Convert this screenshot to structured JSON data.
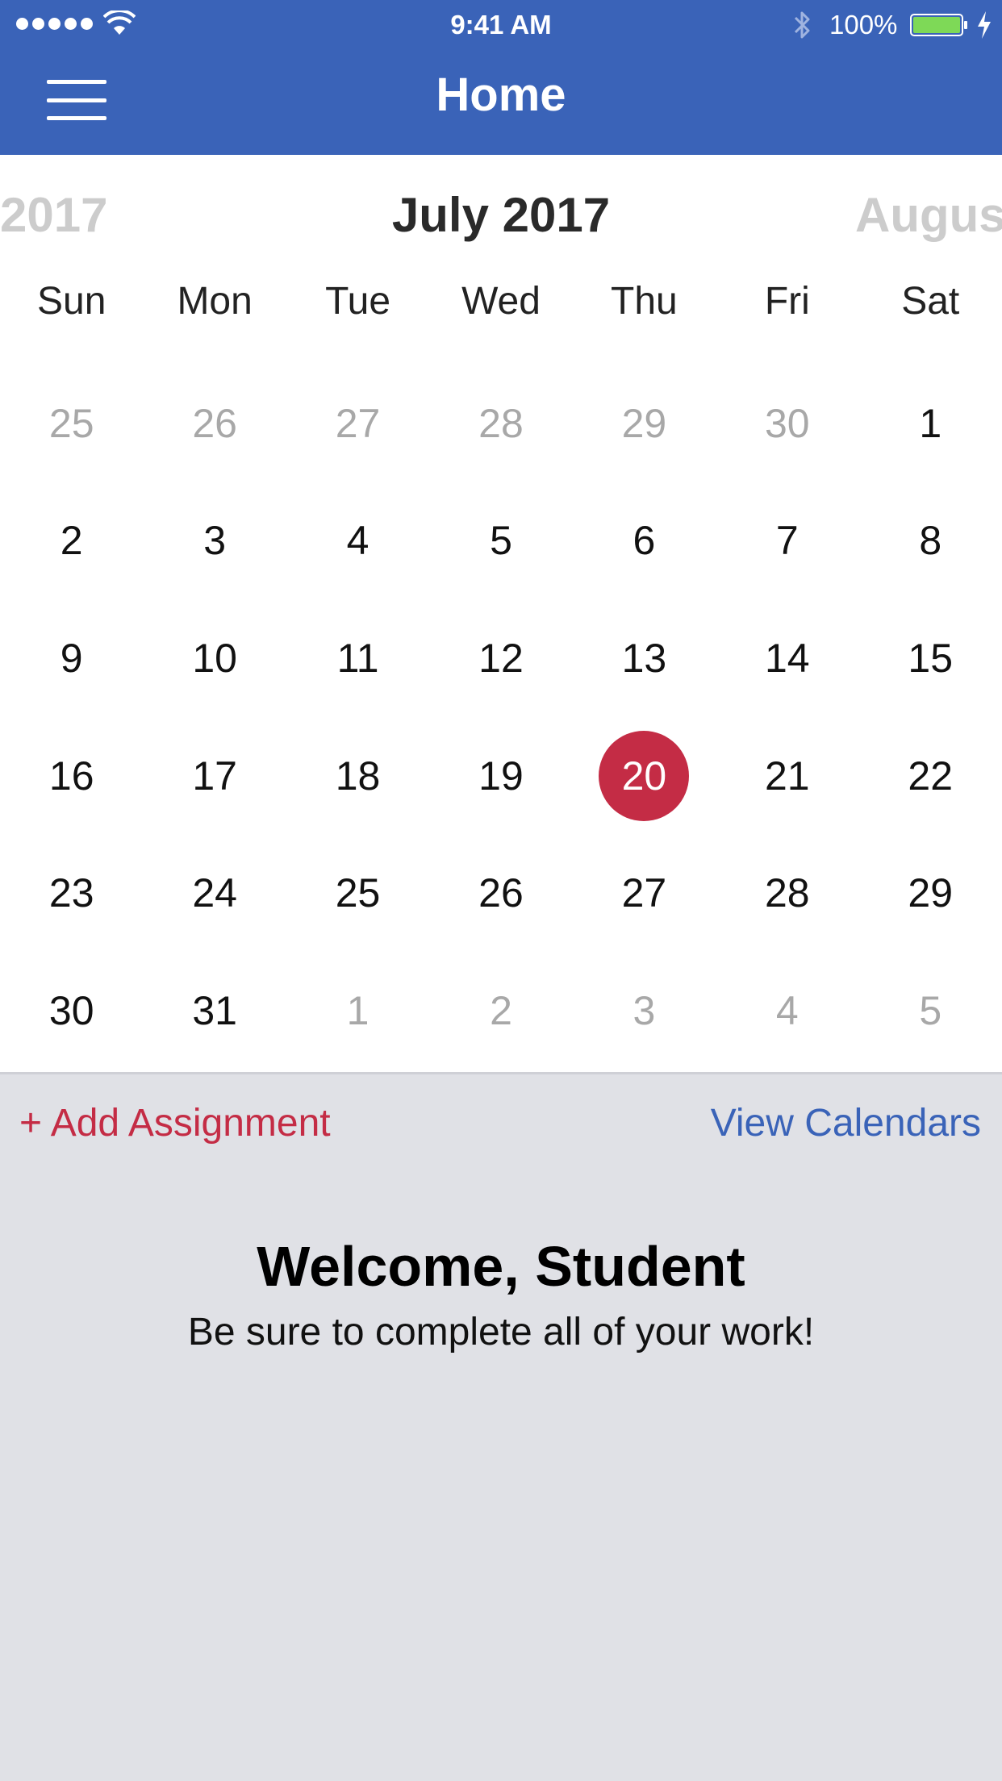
{
  "status_bar": {
    "time": "9:41 AM",
    "battery_percent": "100%",
    "battery_color": "#7ed957"
  },
  "nav": {
    "title": "Home",
    "menu_icon": "hamburger-icon"
  },
  "calendar": {
    "prev_label": "2017",
    "current_label": "July 2017",
    "next_label": "August",
    "weekdays": [
      "Sun",
      "Mon",
      "Tue",
      "Wed",
      "Thu",
      "Fri",
      "Sat"
    ],
    "selected_day": "20",
    "weeks": [
      [
        "25",
        "26",
        "27",
        "28",
        "29",
        "30",
        "1"
      ],
      [
        "2",
        "3",
        "4",
        "5",
        "6",
        "7",
        "8"
      ],
      [
        "9",
        "10",
        "11",
        "12",
        "13",
        "14",
        "15"
      ],
      [
        "16",
        "17",
        "18",
        "19",
        "20",
        "21",
        "22"
      ],
      [
        "23",
        "24",
        "25",
        "26",
        "27",
        "28",
        "29"
      ],
      [
        "30",
        "31",
        "1",
        "2",
        "3",
        "4",
        "5"
      ]
    ]
  },
  "actions": {
    "add_assignment": "+ Add Assignment",
    "view_calendars": "View Calendars"
  },
  "welcome": {
    "title": "Welcome, Student",
    "subtitle": "Be sure to complete all of your work!"
  },
  "colors": {
    "brand_blue": "#3a63b8",
    "accent_red": "#c42c45",
    "background": "#e0e1e6"
  }
}
